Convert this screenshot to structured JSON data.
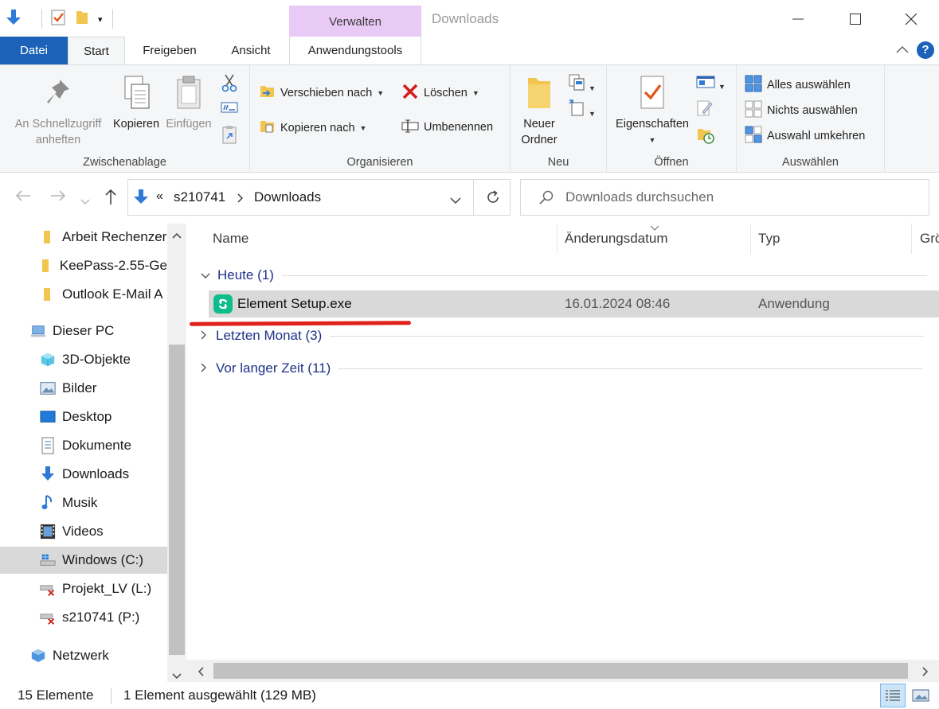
{
  "window": {
    "title": "Downloads",
    "context_tab_header": "Verwalten"
  },
  "ribbon_tabs": {
    "file": "Datei",
    "start": "Start",
    "share": "Freigeben",
    "view": "Ansicht",
    "app_tools": "Anwendungstools"
  },
  "ribbon": {
    "clipboard": {
      "label": "Zwischenablage",
      "pin_line1": "An Schnellzugriff",
      "pin_line2": "anheften",
      "copy": "Kopieren",
      "paste": "Einfügen"
    },
    "organize": {
      "label": "Organisieren",
      "move_to": "Verschieben nach",
      "copy_to": "Kopieren nach",
      "delete": "Löschen",
      "rename": "Umbenennen"
    },
    "new": {
      "label": "Neu",
      "new_folder_line1": "Neuer",
      "new_folder_line2": "Ordner"
    },
    "open": {
      "label": "Öffnen",
      "properties": "Eigenschaften"
    },
    "select": {
      "label": "Auswählen",
      "select_all": "Alles auswählen",
      "select_none": "Nichts auswählen",
      "invert": "Auswahl umkehren"
    }
  },
  "address": {
    "overflow": "«",
    "crumb1": "s210741",
    "crumb2": "Downloads",
    "search_placeholder": "Downloads durchsuchen"
  },
  "nav_pane": {
    "quick_items": [
      "Arbeit Rechenzer",
      "KeePass-2.55-Ge",
      "Outlook E-Mail A"
    ],
    "this_pc": "Dieser PC",
    "pc_items": [
      "3D-Objekte",
      "Bilder",
      "Desktop",
      "Dokumente",
      "Downloads",
      "Musik",
      "Videos",
      "Windows (C:)",
      "Projekt_LV (L:)",
      "s210741 (P:)"
    ],
    "network": "Netzwerk"
  },
  "columns": {
    "name": "Name",
    "date": "Änderungsdatum",
    "type": "Typ",
    "size": "Grö"
  },
  "groups": {
    "today": "Heute (1)",
    "last_month": "Letzten Monat (3)",
    "long_ago": "Vor langer Zeit (11)"
  },
  "files": [
    {
      "name": "Element Setup.exe",
      "date": "16.01.2024 08:46",
      "type": "Anwendung"
    }
  ],
  "status": {
    "count": "15 Elemente",
    "selection": "1 Element ausgewählt (129 MB)"
  },
  "colors": {
    "file_tab": "#1c62b9",
    "context_tab": "#e9c9f5",
    "selection": "#d9d9d9",
    "group_text": "#1e3287",
    "annotation": "#e0201b"
  }
}
